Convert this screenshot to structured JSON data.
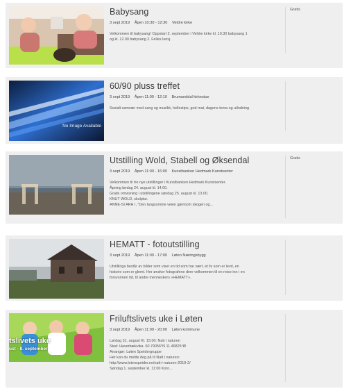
{
  "events": [
    {
      "title": "Babysang",
      "date": "3 sept 2019",
      "time": "Åpen 10:30 - 12:30",
      "place": "Veldre kirke",
      "description": [
        "Velkommen til babysang! Oppstart 2. september i Veldre kirke kl. 10.30 babysang 1",
        "og kl. 12.00 babysang 2. Felles lunsj."
      ],
      "price": "Gratis",
      "image_icon": "babies-photo"
    },
    {
      "title": "60/90 pluss treffet",
      "date": "3 sept 2019",
      "time": "Åpen 11:00 - 12:10",
      "place": "Brumunddal kirkestue",
      "description": [
        "Sosialt samvær med sang og musikk, hellestips, god mat, dagens tema og utlodning"
      ],
      "price": "",
      "image_icon": "light-streak-photo",
      "image_text": "No Image Available"
    },
    {
      "title": "Utstilling   Wold, Stabell og Øksendal",
      "date": "3 sept 2019",
      "time": "Åpen 11:00 - 16:00",
      "place": "Kunstbanken Hedmark Kunstsenter",
      "description": [
        "Velkommen til tre nye utstillinger i Kunstbanken Hedmark Kunstsenter.",
        "Åpning lørdag 24. august kl. 14.00.",
        "Gratis omvisning i utstillingene søndag 25. august kl. 13.00.",
        "KNUT WOLD, skulptur.",
        "ANNE-SI ARH I, \"Den langsomme veien gjennom skogen og..."
      ],
      "price": "Gratis",
      "image_icon": "sculpture-photo"
    },
    {
      "title": "HEMATT - fotoutstilling",
      "date": "3 sept 2019",
      "time": "Åpen 11:00 - 17:00",
      "place": "Løten Næringsbygg",
      "description": [
        "Utstillinga består av bilder som viser en tid som har vært, et liv som er levd, en",
        "historie som er glemt. Her ønsker fotografene dere velkommen til en reise inn i en",
        "forsvunnen tid, til andre menneskers «HEMATT»."
      ],
      "price": "",
      "image_icon": "old-house-photo"
    },
    {
      "title": "Friluftslivets uke i Løten",
      "date": "3 sept 2019",
      "time": "Åpen 11:00 - 20:00",
      "place": "Løten kommune",
      "description": [
        "Lørdag 31. august Kl. 15:00: Natt i naturen",
        "Sted: Haverbækvika. 60.79056°N 11.46825°Ø",
        "Arrangør: Løten Speidergruppe",
        "Her kan du melde deg på til Natt i naturen:",
        "http://www.lotenspeider.no/natt-i-naturen-2019-2/",
        "Søndag 1. september kl. 11:00 Korn..."
      ],
      "price": "",
      "image_icon": "girls-tent-photo",
      "image_text_1": "tslivets uke",
      "image_text_2": "ust - 8. september"
    }
  ]
}
